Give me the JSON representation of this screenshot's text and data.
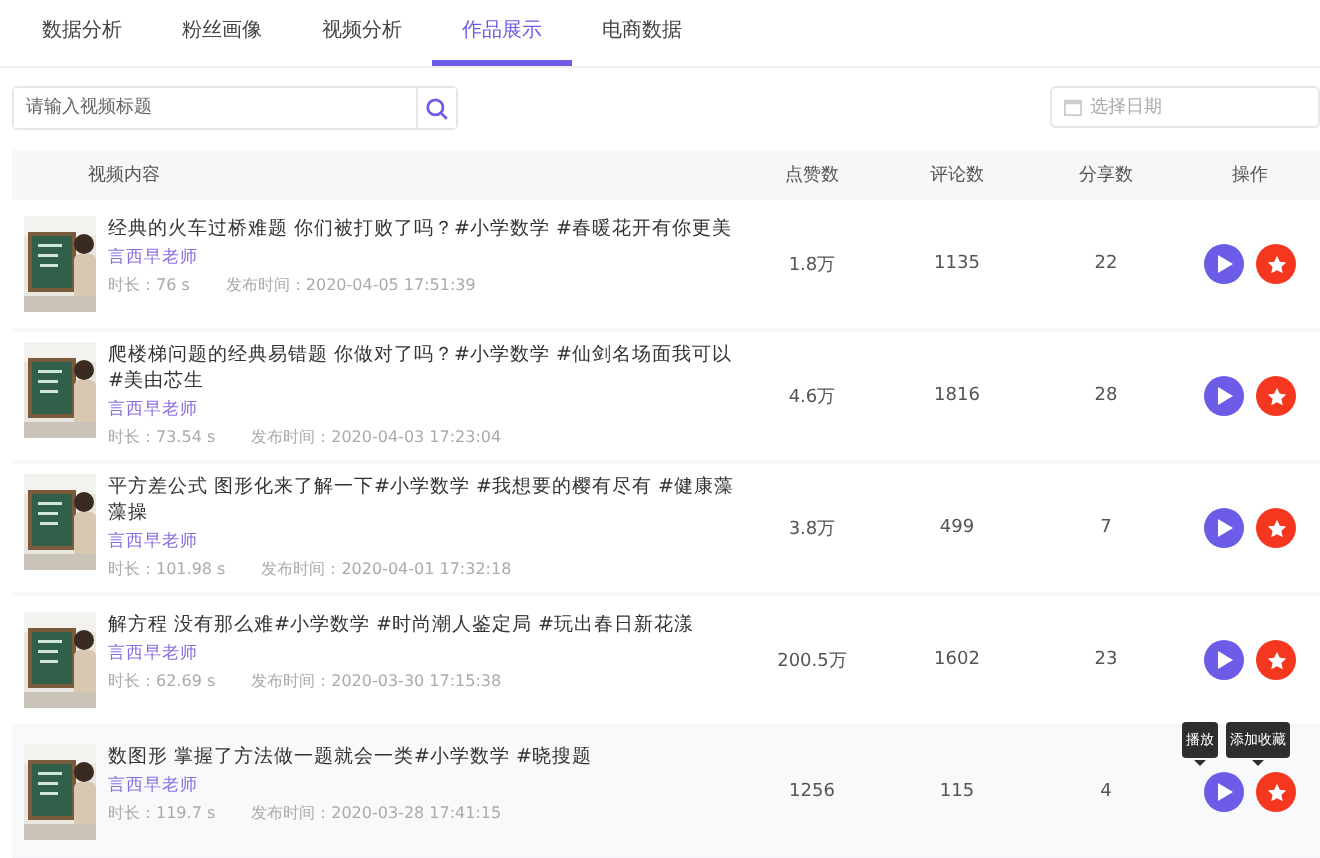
{
  "tabs": [
    {
      "label": "数据分析",
      "selected": false
    },
    {
      "label": "粉丝画像",
      "selected": false
    },
    {
      "label": "视频分析",
      "selected": false
    },
    {
      "label": "作品展示",
      "selected": true
    },
    {
      "label": "电商数据",
      "selected": false
    }
  ],
  "search": {
    "placeholder": "请输入视频标题"
  },
  "date_picker": {
    "placeholder": "选择日期"
  },
  "table": {
    "columns": [
      "视频内容",
      "点赞数",
      "评论数",
      "分享数",
      "操作"
    ],
    "rows": [
      {
        "kind": "picture",
        "title": "经典的火车过桥难题 你们被打败了吗？#小学数学 #春暖花开有你更美",
        "author": "言西早老师",
        "duration": "时长：76 s",
        "published": "发布时间：2020-04-05 17:51:39",
        "likes": "1.8万",
        "comments": "1135",
        "shares": "22",
        "hovered": false
      },
      {
        "kind": "picture",
        "title": "爬楼梯问题的经典易错题 你做对了吗？#小学数学 #仙剑名场面我可以 #美由芯生",
        "author": "言西早老师",
        "duration": "时长：73.54 s",
        "published": "发布时间：2020-04-03 17:23:04",
        "likes": "4.6万",
        "comments": "1816",
        "shares": "28",
        "hovered": false
      },
      {
        "kind": "picture",
        "title": "平方差公式 图形化来了解一下#小学数学 #我想要的樱有尽有 #健康藻藻操",
        "author": "言西早老师",
        "duration": "时长：101.98 s",
        "published": "发布时间：2020-04-01 17:32:18",
        "likes": "3.8万",
        "comments": "499",
        "shares": "7",
        "hovered": false
      },
      {
        "kind": "picture",
        "title": "解方程 没有那么难#小学数学 #时尚潮人鉴定局 #玩出春日新花漾",
        "author": "言西早老师",
        "duration": "时长：62.69 s",
        "published": "发布时间：2020-03-30 17:15:38",
        "likes": "200.5万",
        "comments": "1602",
        "shares": "23",
        "hovered": false
      },
      {
        "kind": "picture",
        "title": "数图形 掌握了方法做一题就会一类#小学数学 #晓搜题",
        "author": "言西早老师",
        "duration": "时长：119.7 s",
        "published": "发布时间：2020-03-28 17:41:15",
        "likes": "1256",
        "comments": "115",
        "shares": "4",
        "hovered": true
      }
    ]
  },
  "tooltips": [
    "播放",
    "添加收藏"
  ]
}
